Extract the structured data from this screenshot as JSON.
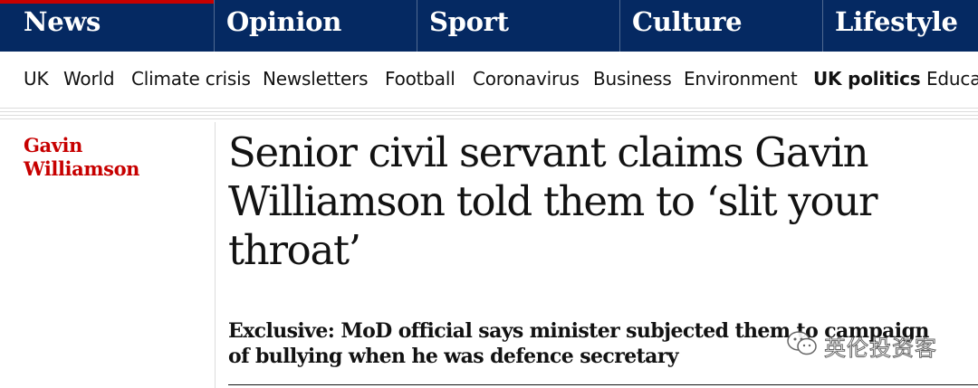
{
  "pillars": [
    {
      "label": "News",
      "active": true
    },
    {
      "label": "Opinion",
      "active": false
    },
    {
      "label": "Sport",
      "active": false
    },
    {
      "label": "Culture",
      "active": false
    },
    {
      "label": "Lifestyle",
      "active": false
    }
  ],
  "subnav": [
    {
      "label": "UK"
    },
    {
      "label": "World"
    },
    {
      "label": "Climate crisis"
    },
    {
      "label": "Newsletters"
    },
    {
      "label": "Football"
    },
    {
      "label": "Coronavirus"
    },
    {
      "label": "Business"
    },
    {
      "label": "Environment"
    },
    {
      "label": "UK politics",
      "bold": true
    },
    {
      "label": "Educa"
    }
  ],
  "article": {
    "kicker": "Gavin Williamson",
    "headline": "Senior civil servant claims Gavin Williamson told them to ‘slit your throat’",
    "standfirst": "Exclusive: MoD official says minister subjected them to campaign of bullying when he was defence secretary"
  },
  "watermark": {
    "text": "英伦投资客",
    "icon": "wechat-icon"
  },
  "colors": {
    "brand_navy": "#052962",
    "news_red": "#c70000",
    "text": "#121212"
  }
}
